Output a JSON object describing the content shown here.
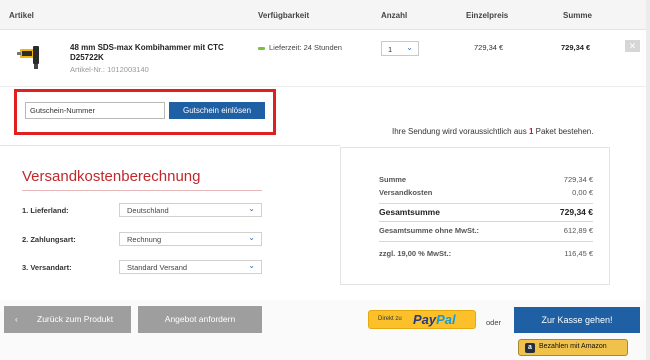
{
  "table_header": {
    "artikel": "Artikel",
    "verfuegbarkeit": "Verfügbarkeit",
    "anzahl": "Anzahl",
    "einzelpreis": "Einzelpreis",
    "summe": "Summe"
  },
  "product": {
    "title": "48 mm SDS-max Kombihammer mit CTC D25722K",
    "article_no": "Artikel-Nr.: 1012003140",
    "availability": "Lieferzeit: 24 Stunden",
    "availability_color": "#7bc043",
    "quantity": "1",
    "unit_price": "729,34 €",
    "sum_price": "729,34 €",
    "remove_icon": "close-icon"
  },
  "coupon": {
    "placeholder": "Gutschein-Nummer",
    "value": "Gutschein-Nummer",
    "button_label": "Gutschein einlösen",
    "highlight_color": "#e0201e"
  },
  "shipping_note": {
    "before": "Ihre Sendung wird voraussichtlich aus ",
    "count": "1",
    "after": " Paket bestehen."
  },
  "shipping_calc": {
    "title": "Versandkostenberechnung",
    "fields": [
      {
        "label": "1. Lieferland:",
        "value": "Deutschland"
      },
      {
        "label": "2. Zahlungsart:",
        "value": "Rechnung"
      },
      {
        "label": "3. Versandart:",
        "value": "Standard Versand"
      }
    ]
  },
  "totals": {
    "summe_label": "Summe",
    "summe_value": "729,34 €",
    "versand_label": "Versandkosten",
    "versand_value": "0,00 €",
    "gesamt_label": "Gesamtsumme",
    "gesamt_value": "729,34 €",
    "ohne_mwst_label": "Gesamtsumme ohne MwSt.:",
    "ohne_mwst_value": "612,89 €",
    "mwst_label": "zzgl. 19,00 % MwSt.:",
    "mwst_value": "116,45 €"
  },
  "actions": {
    "back_label": "Zurück zum Produkt",
    "back_icon": "chevron-left-icon",
    "offer_label": "Angebot anfordern",
    "paypal_prefix": "Direkt zu",
    "paypal_pay": "Pay",
    "paypal_pal": "Pal",
    "oder": "oder",
    "checkout_label": "Zur Kasse gehen!",
    "amazon_label": "Bezahlen mit Amazon",
    "accent_color": "#1f5fa3"
  }
}
